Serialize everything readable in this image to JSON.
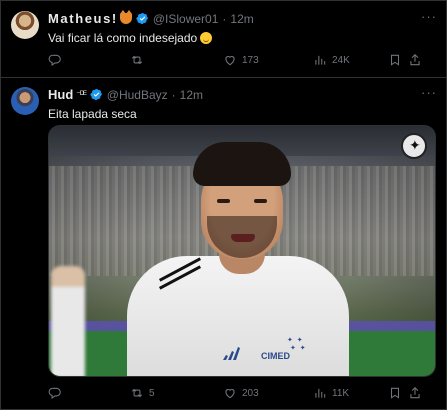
{
  "tweets": [
    {
      "name": "Matheus!",
      "name_suffix": "",
      "emoji_icon": "fox-emoji",
      "verified": true,
      "handle": "@ISlower01",
      "separator": "·",
      "time": "12m",
      "text": "Vai ficar lá como indesejado",
      "text_emoji": "grinning-face-with-sweat-emoji",
      "replies": "",
      "retweets": "",
      "likes": "173",
      "views": "24K"
    },
    {
      "name": "Hud",
      "name_suffix": "⁻ᴰᴱ",
      "verified": true,
      "handle": "@HudBayz",
      "separator": "·",
      "time": "12m",
      "text": "Eita lapada seca",
      "media": {
        "sponsor_text": "CIMED"
      },
      "replies": "",
      "retweets": "5",
      "likes": "203",
      "views": "11K"
    }
  ],
  "colors": {
    "background": "#000000",
    "text": "#e7e9ea",
    "muted": "#71767b",
    "border": "#2f3336",
    "verified": "#1d9bf0"
  }
}
